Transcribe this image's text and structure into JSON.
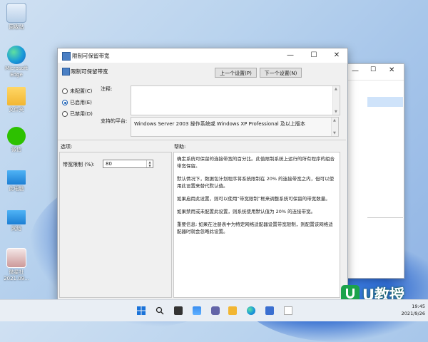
{
  "desktop": {
    "icons": [
      {
        "label": "回收站"
      },
      {
        "label": "Microsoft Edge"
      },
      {
        "label": "文件夹"
      },
      {
        "label": "微信"
      },
      {
        "label": "此电脑"
      },
      {
        "label": "网络"
      },
      {
        "label": "微星社 2021.09..."
      }
    ]
  },
  "dialog": {
    "title": "限制可保留带宽",
    "header_title": "限制可保留带宽",
    "prev_button": "上一个设置(P)",
    "next_button": "下一个设置(N)",
    "radio_options": [
      {
        "label": "未配置(C)",
        "selected": false
      },
      {
        "label": "已启用(E)",
        "selected": true
      },
      {
        "label": "已禁用(D)",
        "selected": false
      }
    ],
    "note_label": "注释:",
    "platform_label": "支持的平台:",
    "platform_value": "Windows Server 2003 操作系统或 Windows XP Professional 及以上版本",
    "options_label": "选项:",
    "help_label": "帮助:",
    "bandwidth_label": "带宽限制 (%):",
    "bandwidth_value": "80",
    "help_paragraphs": [
      "确定系统可保留的连接带宽的百分比。此值限制系统上运行的所有程序的组合带宽保留。",
      "默认情况下，数据包计划程序将系统限制在 20% 的连接带宽之内，但可以使用此设置来替代默认值。",
      "如果启用此设置，则可以使用“带宽限制”框来调整系统可保留的带宽数量。",
      "如果禁用或未配置此设置，则系统使用默认值为 20% 的连接带宽。",
      "重要信息: 如果在注册表中为特定网络适配器设置带宽限制，则配置该网络适配器时就会忽略此设置。"
    ]
  },
  "watermark": {
    "text": "U教授"
  },
  "taskbar": {
    "time": "19:45",
    "date": "2021/9/26"
  }
}
